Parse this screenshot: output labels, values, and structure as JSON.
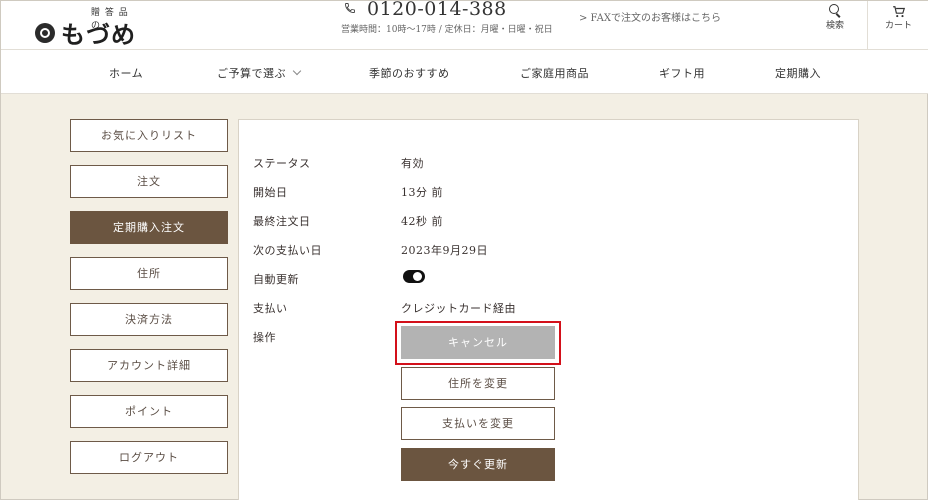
{
  "header": {
    "logo_sub": "贈 答 品 の",
    "logo_text": "もづめ",
    "phone": "0120-014-388",
    "hours": "営業時間：10時〜17時 / 定休日：月曜・日曜・祝日",
    "fax_link": "> FAXで注文のお客様はこちら",
    "search_label": "検索",
    "cart_label": "カート"
  },
  "nav": {
    "items": [
      {
        "label": "ホーム"
      },
      {
        "label": "ご予算で選ぶ"
      },
      {
        "label": "季節のおすすめ"
      },
      {
        "label": "ご家庭用商品"
      },
      {
        "label": "ギフト用"
      },
      {
        "label": "定期購入"
      }
    ]
  },
  "sidebar": {
    "items": [
      {
        "label": "お気に入りリスト"
      },
      {
        "label": "注文"
      },
      {
        "label": "定期購入注文",
        "active": true
      },
      {
        "label": "住所"
      },
      {
        "label": "決済方法"
      },
      {
        "label": "アカウント詳細"
      },
      {
        "label": "ポイント"
      },
      {
        "label": "ログアウト"
      }
    ]
  },
  "details": {
    "rows": [
      {
        "label": "ステータス",
        "value": "有効"
      },
      {
        "label": "開始日",
        "value": "13分 前"
      },
      {
        "label": "最終注文日",
        "value": "42秒 前"
      },
      {
        "label": "次の支払い日",
        "value": "2023年9月29日"
      },
      {
        "label": "自動更新",
        "value": ""
      },
      {
        "label": "支払い",
        "value": "クレジットカード経由"
      },
      {
        "label": "操作",
        "value": ""
      }
    ],
    "auto_renew_on": true
  },
  "actions": {
    "cancel": "キャンセル",
    "change_address": "住所を変更",
    "change_payment": "支払いを変更",
    "renew_now": "今すぐ更新"
  },
  "colors": {
    "brand_brown": "#6b5540",
    "highlight_red": "#d3101a",
    "disabled_gray": "#b3b3b3"
  }
}
